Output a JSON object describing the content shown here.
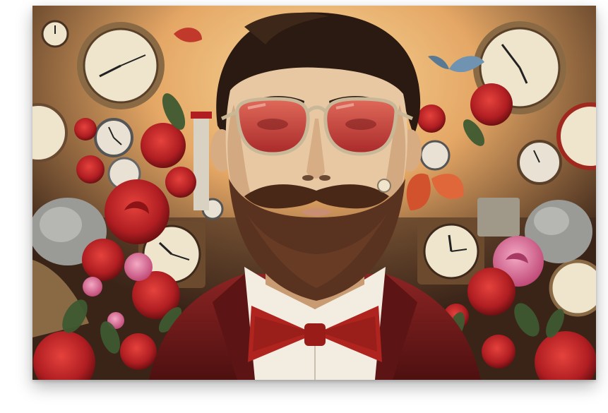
{
  "artwork": {
    "subject": "bearded-man-portrait",
    "palette": {
      "background_glow": "#f2c27a",
      "background_dark": "#3a2418",
      "jacket": "#7a1c1c",
      "bowtie": "#b0241f",
      "lenses": "#c9453c",
      "beard": "#5a3220",
      "hair": "#2a1a12",
      "skin": "#e8c8a3",
      "rose": "#c8262a",
      "pink_rose": "#e67aa0",
      "clock_face": "#efe4cc"
    }
  }
}
